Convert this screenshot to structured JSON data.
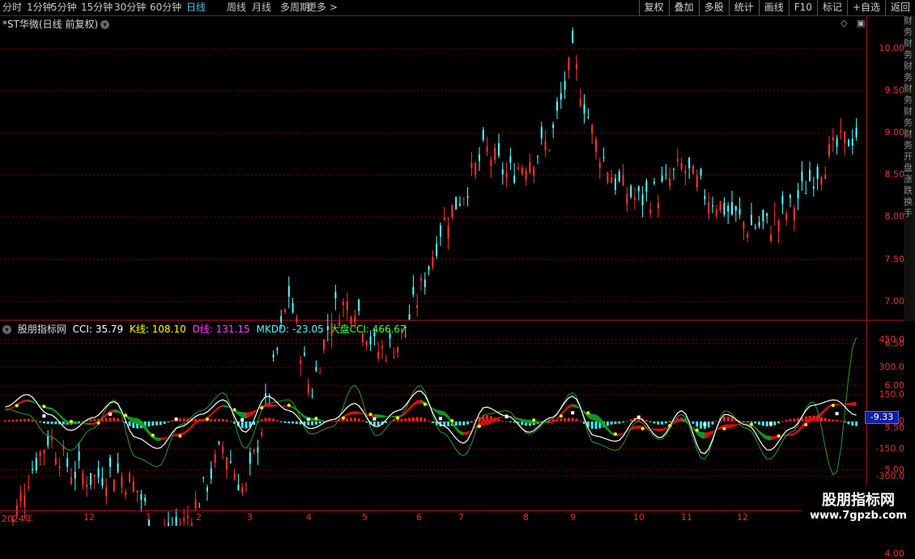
{
  "toolbar": {
    "periods": [
      "分时",
      "1分钟",
      "5分钟",
      "15分钟",
      "30分钟",
      "60分钟",
      "日线",
      "周线",
      "月线",
      "多周期",
      "更多 >"
    ],
    "active_period": "日线",
    "buttons": [
      "复权",
      "叠加",
      "多股",
      "统计",
      "画线",
      "F10",
      "标记",
      "+自选",
      "返回"
    ]
  },
  "stock": {
    "title": "*ST华微(日线 前复权)",
    "dropdown_icon": "chevron-down-icon"
  },
  "indicator": {
    "name": "股朋指标网",
    "cci": "CCI: 35.79",
    "k": "K线: 108.10",
    "d": "D线: 131.15",
    "mkdd": "MKDD: -23.05",
    "market_cci": "大盘CCI: 466.67",
    "colors": {
      "cci": "#ffffff",
      "k": "#ffff00",
      "d": "#ff44ff",
      "mkdd": "#44ffff",
      "market_cci": "#44ff44"
    }
  },
  "price_axis": [
    "10.00",
    "9.50",
    "9.00",
    "8.50",
    "8.00",
    "7.50",
    "7.00",
    "6.50",
    "6.00",
    "5.50",
    "5.00",
    "4.50",
    "4.00"
  ],
  "indicator_axis": [
    "450.0",
    "300.0",
    "150.0",
    "0",
    "-150.0",
    "-300.0"
  ],
  "current_value": "-9.33",
  "date_axis": [
    "2024年",
    "12",
    "1",
    "2",
    "3",
    "4",
    "5",
    "6",
    "7",
    "8",
    "9",
    "10",
    "11",
    "12"
  ],
  "side_panel_text": "财务财务财务财务财务财务开盘涨跌换手",
  "watermark": {
    "title": "股朋指标网",
    "url": "www.7gpzb.com"
  },
  "colors": {
    "up": "#ff3333",
    "down": "#54ffff",
    "grid": "#7a0000",
    "axis": "#cc2222"
  },
  "chart_data": [
    {
      "type": "candlestick",
      "title": "*ST华微(日线 前复权)",
      "ylim": [
        3.8,
        10.5
      ],
      "x_labels": [
        "2024年",
        "12",
        "1",
        "2",
        "3",
        "4",
        "5",
        "6",
        "7",
        "8",
        "9",
        "10",
        "11",
        "12"
      ],
      "close_approx": [
        4.1,
        4.9,
        5.4,
        5.0,
        4.9,
        5.0,
        4.8,
        4.2,
        4.3,
        4.7,
        5.3,
        4.7,
        5.8,
        7.1,
        5.9,
        6.9,
        7.0,
        6.4,
        6.5,
        7.1,
        7.9,
        8.3,
        8.8,
        8.5,
        8.7,
        8.9,
        9.9,
        8.9,
        8.4,
        8.2,
        8.3,
        8.6,
        8.3,
        8.1,
        7.9,
        7.9,
        8.1,
        8.5,
        8.8,
        9.0
      ]
    },
    {
      "type": "line",
      "title": "股朋指标网",
      "ylim": [
        -360,
        500
      ],
      "series": [
        {
          "name": "CCI",
          "values": [
            80,
            150,
            40,
            -50,
            20,
            110,
            -90,
            -150,
            -30,
            40,
            120,
            -60,
            140,
            60,
            -40,
            10,
            100,
            -30,
            60,
            170,
            -20,
            -120,
            80,
            30,
            -60,
            20,
            140,
            -80,
            -110,
            20,
            -90,
            60,
            -180,
            40,
            -20,
            -160,
            -40,
            90,
            120,
            35
          ]
        },
        {
          "name": "K线",
          "values": [
            60,
            110,
            80,
            0,
            -20,
            50,
            20,
            -90,
            -80,
            0,
            80,
            50,
            80,
            90,
            20,
            0,
            40,
            40,
            20,
            100,
            60,
            -60,
            -20,
            30,
            10,
            -10,
            80,
            40,
            -70,
            -40,
            -40,
            0,
            -60,
            -40,
            -10,
            -80,
            -80,
            0,
            90,
            108
          ]
        },
        {
          "name": "大盘CCI",
          "values": [
            70,
            40,
            -80,
            -160,
            -40,
            120,
            -200,
            -250,
            -20,
            60,
            160,
            -150,
            100,
            120,
            -70,
            -30,
            200,
            -80,
            20,
            200,
            -60,
            -190,
            40,
            60,
            -70,
            10,
            160,
            -120,
            -160,
            0,
            -100,
            40,
            -210,
            60,
            -40,
            -210,
            -60,
            110,
            -300,
            466
          ]
        }
      ]
    }
  ]
}
